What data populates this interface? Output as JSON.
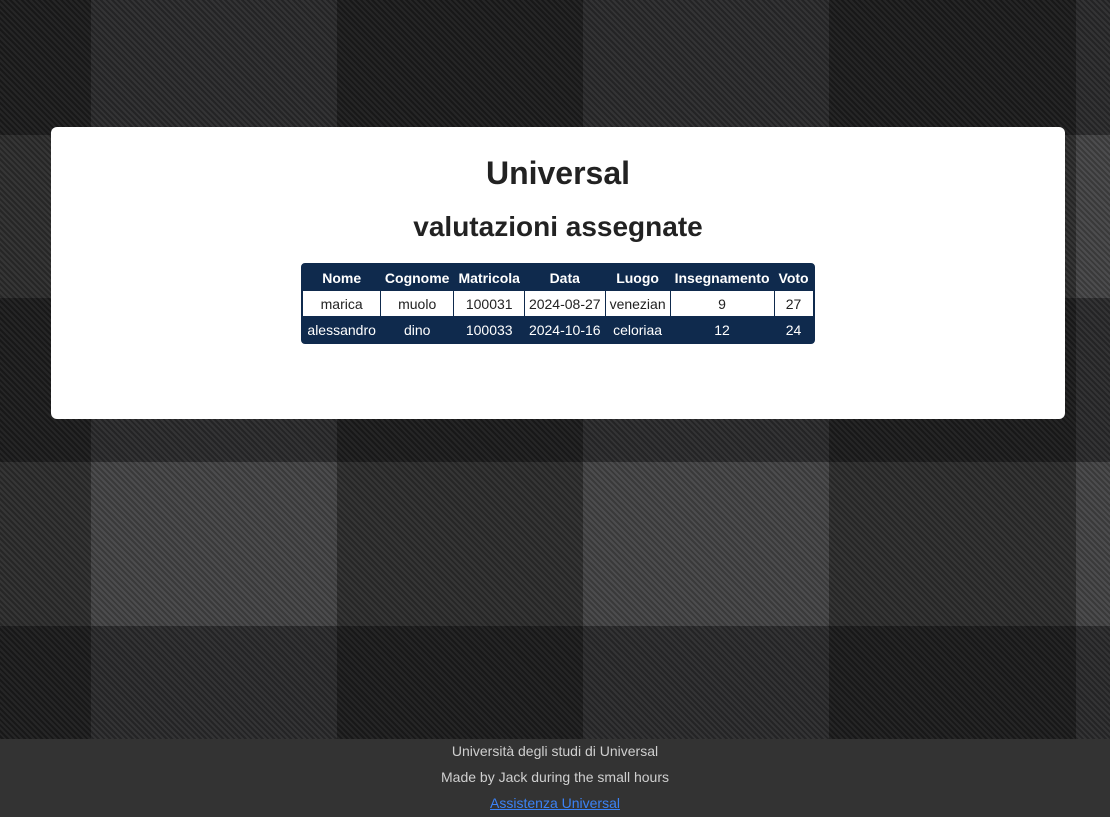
{
  "header": {
    "title": "Universal",
    "subtitle": "valutazioni assegnate"
  },
  "table": {
    "columns": [
      "Nome",
      "Cognome",
      "Matricola",
      "Data",
      "Luogo",
      "Insegnamento",
      "Voto"
    ],
    "rows": [
      [
        "marica",
        "muolo",
        "100031",
        "2024-08-27",
        "venezian",
        "9",
        "27"
      ],
      [
        "alessandro",
        "dino",
        "100033",
        "2024-10-16",
        "celoriaa",
        "12",
        "24"
      ]
    ]
  },
  "footer": {
    "line1": "Università degli studi di Universal",
    "line2": "Made by Jack during the small hours",
    "link": "Assistenza Universal"
  },
  "colors": {
    "table_header": "#0f2a4d",
    "footer_bg": "#333333",
    "link": "#3b82f6"
  }
}
